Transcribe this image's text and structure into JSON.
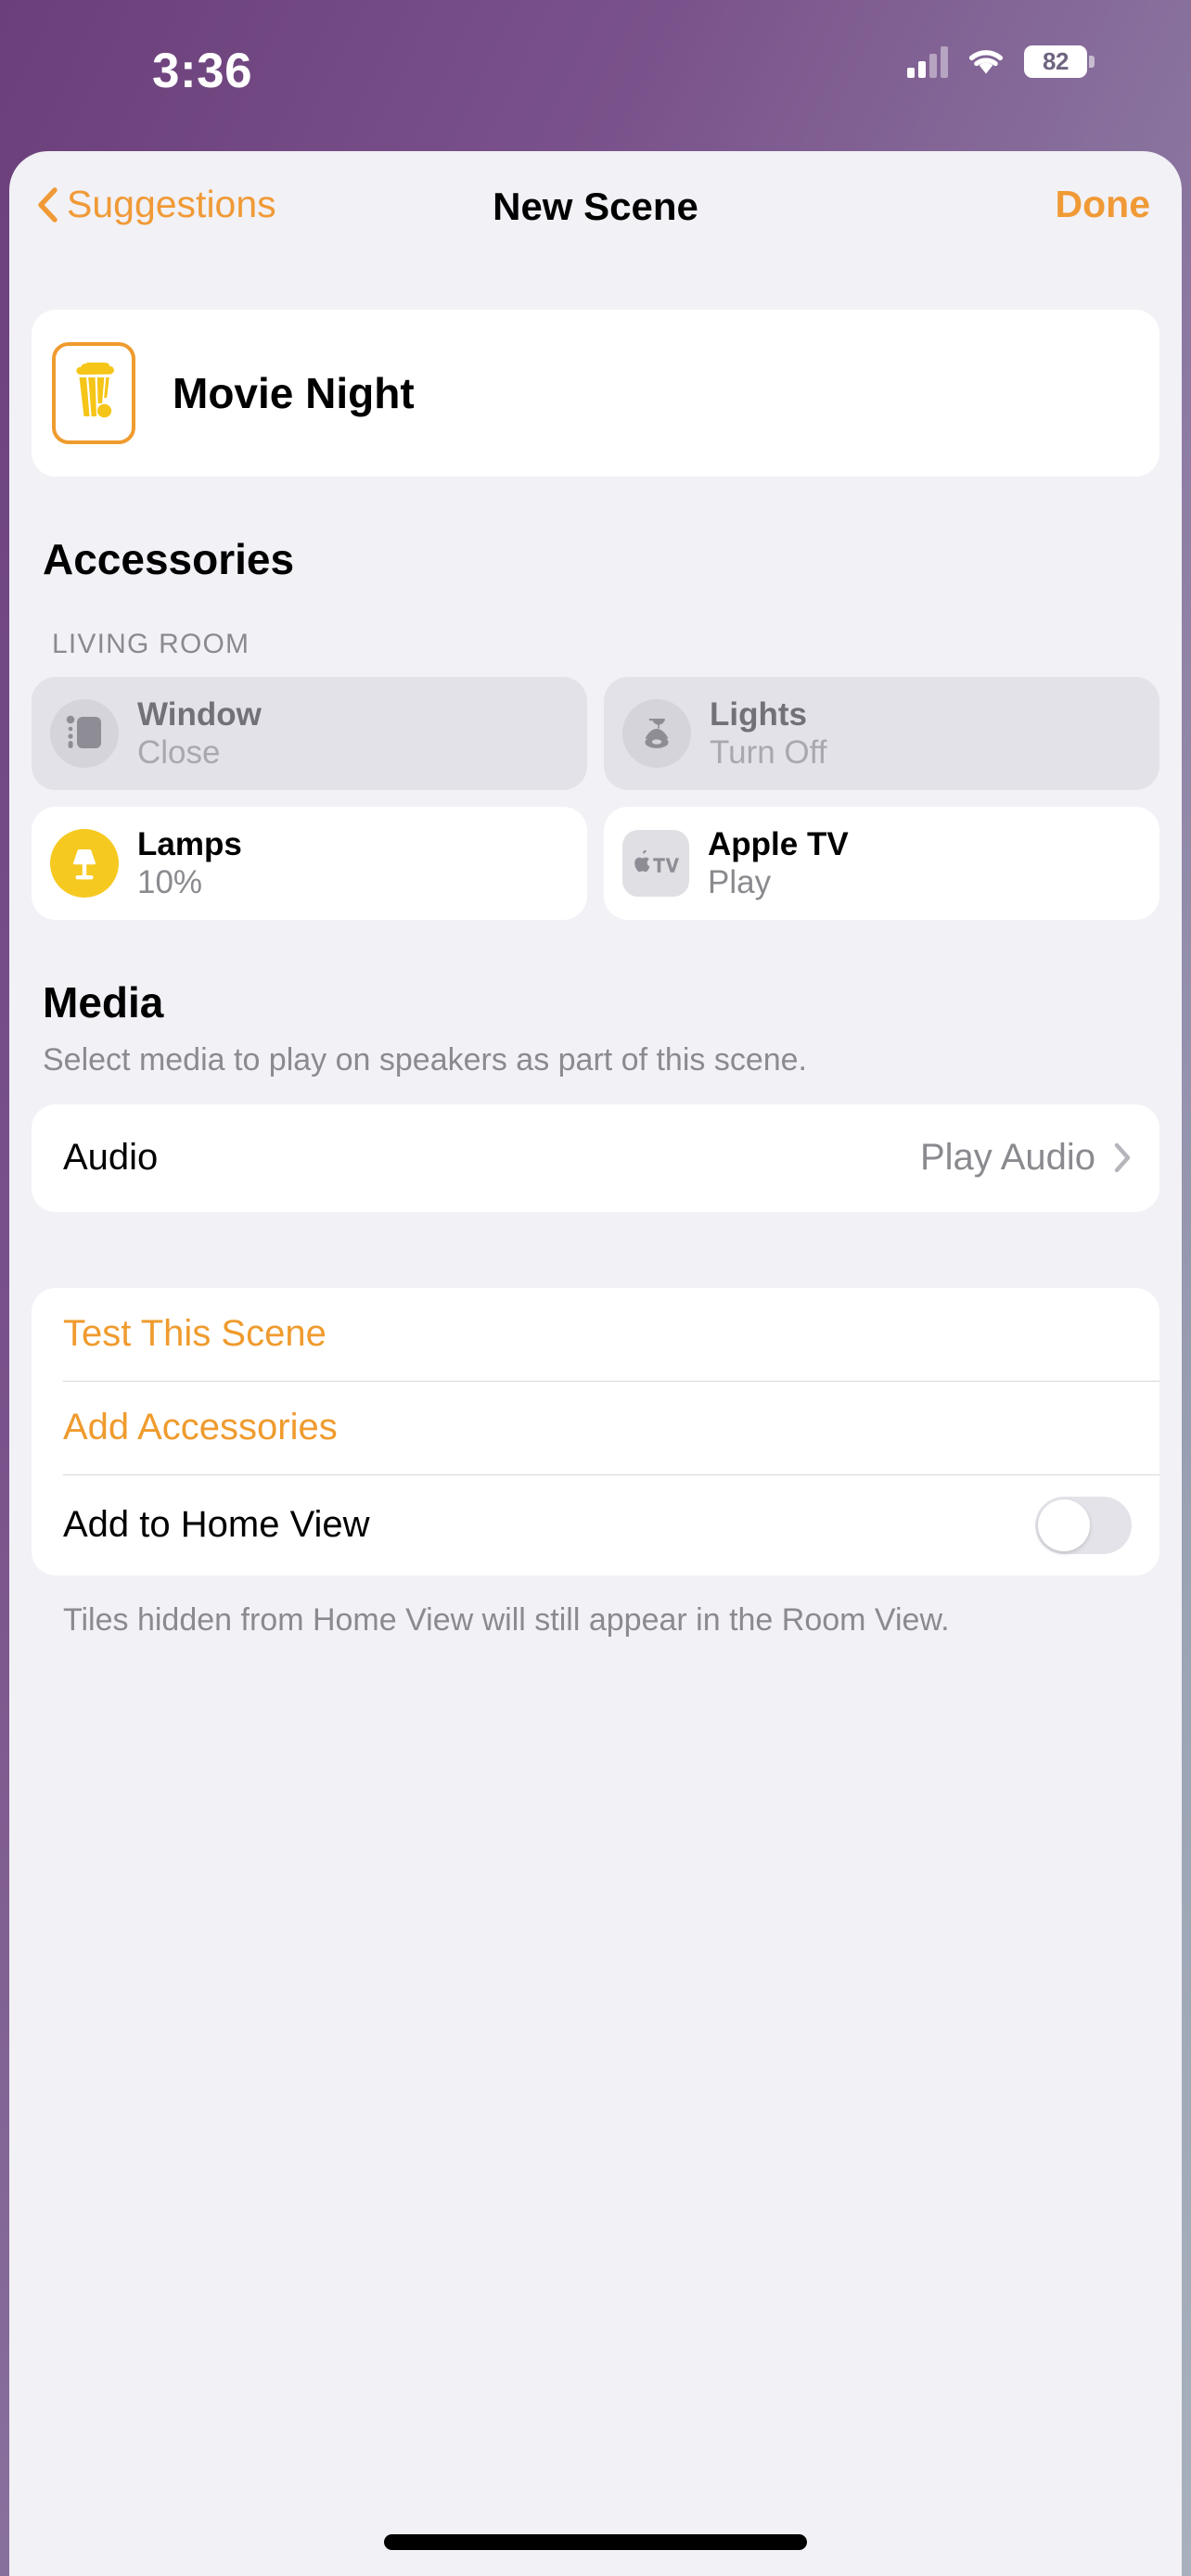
{
  "status_bar": {
    "time": "3:36",
    "battery_percent": "82",
    "cellular_icon": "cellular-bars-icon",
    "wifi_icon": "wifi-icon",
    "battery_icon": "battery-icon"
  },
  "nav": {
    "back_label": "Suggestions",
    "back_icon": "chevron-left-icon",
    "title": "New Scene",
    "done_label": "Done"
  },
  "scene": {
    "name": "Movie Night",
    "icon": "popcorn-icon",
    "icon_border_color": "#ef9b2e"
  },
  "accessories": {
    "heading": "Accessories",
    "group_label": "LIVING ROOM",
    "tiles": [
      {
        "name": "Window",
        "state": "Close",
        "icon": "window-covering-icon",
        "active": false,
        "badge_style": "grey-circle"
      },
      {
        "name": "Lights",
        "state": "Turn Off",
        "icon": "pendant-light-icon",
        "active": false,
        "badge_style": "grey-circle"
      },
      {
        "name": "Lamps",
        "state": "10%",
        "icon": "table-lamp-icon",
        "active": true,
        "badge_style": "yellow-circle",
        "badge_color": "#f6c921"
      },
      {
        "name": "Apple TV",
        "state": "Play",
        "icon": "apple-tv-icon",
        "active": true,
        "badge_style": "grey-rounded-square"
      }
    ]
  },
  "media": {
    "heading": "Media",
    "description": "Select media to play on speakers as part of this scene.",
    "audio_label": "Audio",
    "audio_value": "Play Audio",
    "disclosure_icon": "chevron-right-icon"
  },
  "actions": {
    "test_scene": "Test This Scene",
    "add_accessories": "Add Accessories",
    "add_to_home_view": "Add to Home View",
    "toggle_state": "off",
    "footnote": "Tiles hidden from Home View will still appear in the Room View."
  },
  "theme": {
    "accent": "#ef9b2e",
    "sheet_background": "#f2f1f6",
    "card_background": "#ffffff",
    "inactive_tile": "#e3e2e8",
    "secondary_text": "#8a8a8f"
  }
}
